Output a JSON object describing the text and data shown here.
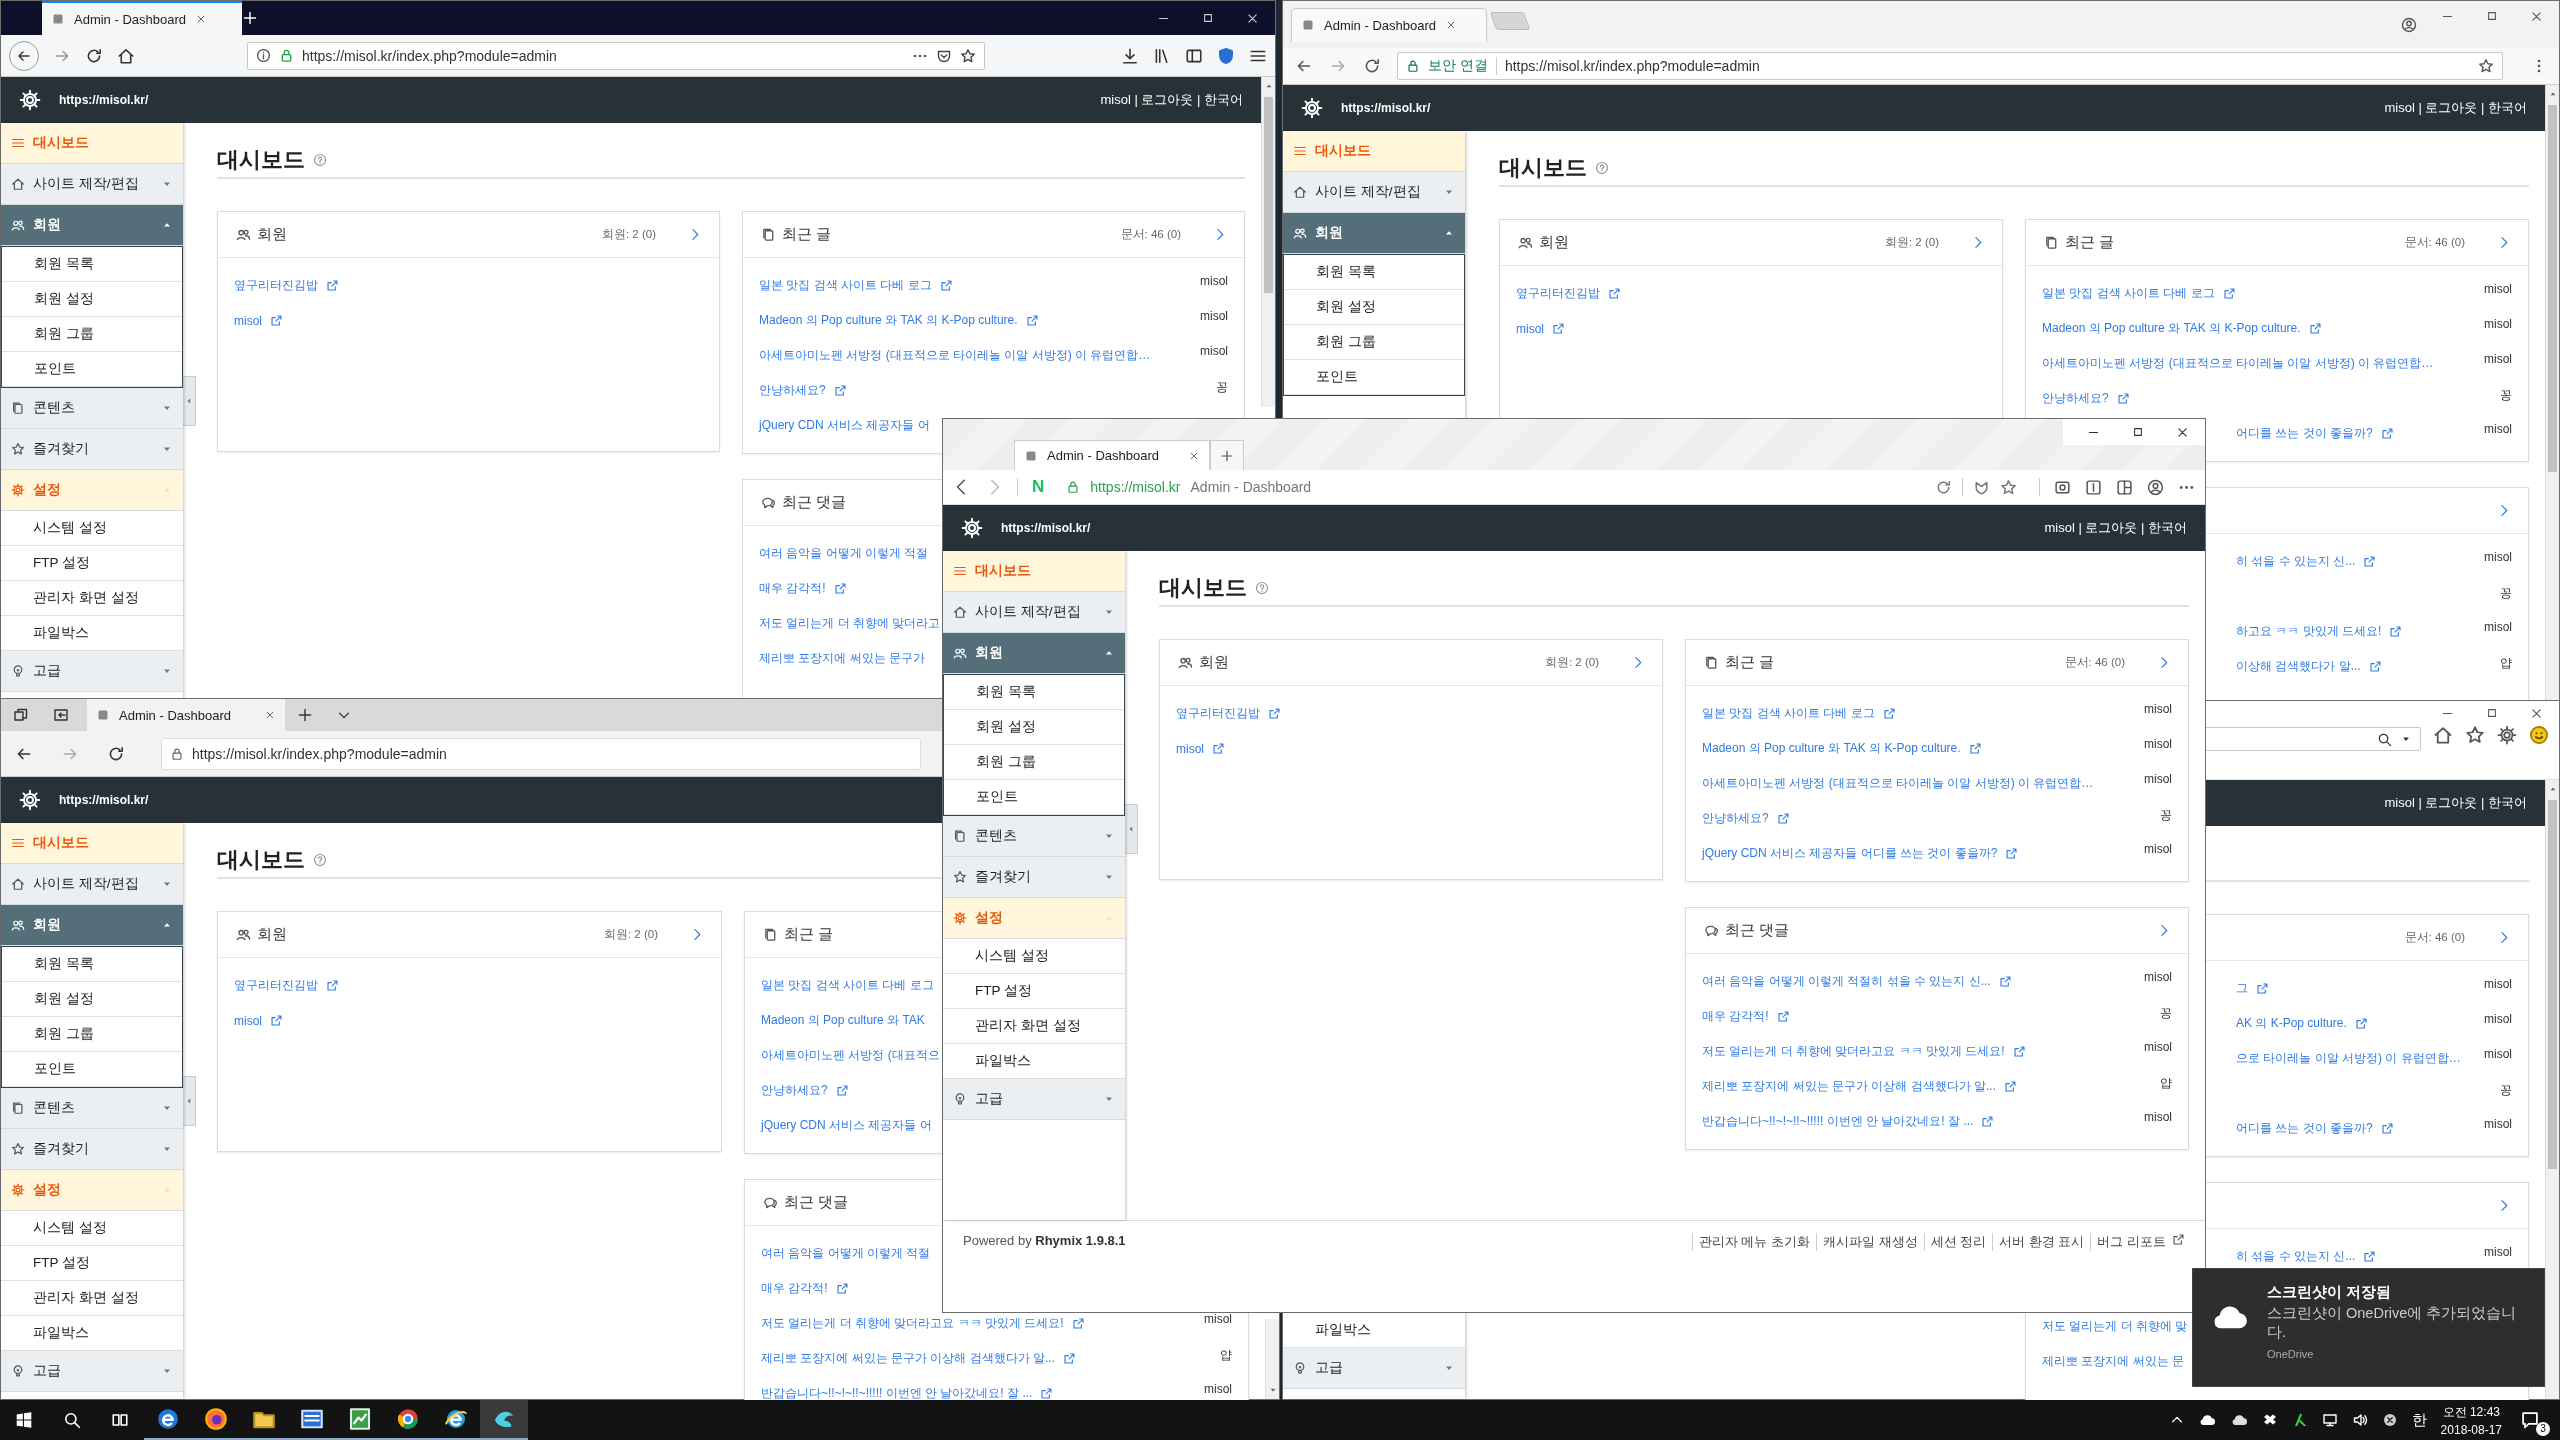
{
  "windows": [
    {
      "kind": "firefox",
      "tabs": [
        {
          "label": "Admin - Dashboard",
          "selected": true
        }
      ],
      "address": "https://misol.kr/index.php?module=admin",
      "site": "https://misol.kr/",
      "account": "misol | 로그아웃 | 한국어",
      "sidebar": [
        {
          "label": "대시보드",
          "kind": "link",
          "selected": true
        },
        {
          "label": "사이트 제작/편집",
          "kind": "group",
          "selected": false,
          "expanded": false
        },
        {
          "label": "회원",
          "kind": "group",
          "selected": false,
          "expanded": true,
          "children": [
            {
              "label": "회원 목록"
            },
            {
              "label": "회원 설정"
            },
            {
              "label": "회원 그룹"
            },
            {
              "label": "포인트"
            }
          ]
        },
        {
          "label": "콘텐츠",
          "kind": "group",
          "selected": false,
          "expanded": false
        },
        {
          "label": "즐겨찾기",
          "kind": "group",
          "selected": false,
          "expanded": false
        },
        {
          "label": "설정",
          "kind": "group",
          "selected": true,
          "expanded": true,
          "children": [
            {
              "label": "시스템 설정"
            },
            {
              "label": "FTP 설정"
            },
            {
              "label": "관리자 화면 설정"
            },
            {
              "label": "파일박스"
            }
          ]
        },
        {
          "label": "고급",
          "kind": "group",
          "selected": false,
          "expanded": false
        }
      ],
      "title": "대시보드",
      "cards": [
        {
          "title": "회원",
          "count": "회원: 2 (0)",
          "rows": [
            {
              "text": "옆구리터진김밥",
              "kind": "link"
            },
            {
              "text": "misol",
              "kind": "link"
            }
          ]
        },
        {
          "title": "최근 글",
          "count": "문서: 46 (0)",
          "rows": [
            {
              "text": "일본 맛집 검색 사이트 다베 로그",
              "kind": "link",
              "author": "misol"
            },
            {
              "text": "Madeon 의 Pop culture 와 TAK 의 K-Pop culture.",
              "kind": "link",
              "author": "misol"
            },
            {
              "text": "아세트아미노펜 서방정 (대표적으로 타이레놀 이알 서방정) 이 유럽연합…",
              "kind": "text",
              "author": "misol"
            },
            {
              "text": "안냥하세요?",
              "kind": "link",
              "author": "꽁"
            },
            {
              "text": "jQuery CDN 서비스 제공자들 어",
              "kind": "text"
            }
          ]
        },
        {
          "title": "최근 댓글",
          "rows": [
            {
              "text": "여러 음악을 어떻게 이렇게 적절",
              "kind": "text"
            },
            {
              "text": "매우 감각적!",
              "kind": "link"
            },
            {
              "text": "저도 얼리는게 더 취향에 맞더라고",
              "kind": "text"
            },
            {
              "text": "제리뽀 포장지에 써있는 문구가",
              "kind": "text"
            }
          ]
        }
      ]
    },
    {
      "kind": "chrome",
      "tabs": [
        {
          "label": "Admin - Dashboard",
          "selected": true
        }
      ],
      "security": "보안 연결",
      "address": "https://misol.kr/index.php?module=admin",
      "site": "https://misol.kr/",
      "account": "misol | 로그아웃 | 한국어",
      "sidebar": [
        {
          "label": "대시보드",
          "kind": "link",
          "selected": true
        },
        {
          "label": "사이트 제작/편집",
          "kind": "group",
          "selected": false,
          "expanded": false
        },
        {
          "label": "회원",
          "kind": "group",
          "selected": false,
          "expanded": true,
          "children": [
            {
              "label": "회원 목록"
            },
            {
              "label": "회원 설정"
            },
            {
              "label": "회원 그룹"
            },
            {
              "label": "포인트"
            }
          ]
        }
      ],
      "title": "대시보드",
      "cards": [
        {
          "title": "회원",
          "count": "회원: 2 (0)",
          "rows": [
            {
              "text": "옆구리터진김밥",
              "kind": "link"
            },
            {
              "text": "misol",
              "kind": "link"
            }
          ]
        },
        {
          "title": "최근 글",
          "count": "문서: 46 (0)",
          "rows": [
            {
              "text": "일본 맛집 검색 사이트 다베 로그",
              "kind": "link",
              "author": "misol"
            },
            {
              "text": "Madeon 의 Pop culture 와 TAK 의 K-Pop culture.",
              "kind": "link",
              "author": "misol"
            },
            {
              "text": "아세트아미노펜 서방정 (대표적으로 타이레놀 이알 서방정) 이 유럽연합…",
              "kind": "text",
              "author": "misol"
            },
            {
              "text": "안냥하세요?",
              "kind": "link",
              "author": "꽁"
            },
            {
              "text": "어디를 쓰는 것이 좋을까?",
              "kind": "tail-link",
              "author": "misol"
            }
          ]
        },
        {
          "rows": [
            {
              "text": "히 섞을 수 있는지 신...",
              "kind": "tail-link",
              "author": "misol"
            },
            {
              "kind": "blank",
              "author": "꽁"
            },
            {
              "text": "하고요 ㅋㅋ 맛있게 드세요!",
              "kind": "tail-link",
              "author": "misol"
            },
            {
              "text": "이상해 검색했다가 알...",
              "kind": "tail-link",
              "author": "얍"
            }
          ]
        }
      ]
    },
    {
      "kind": "whale",
      "tabs": [
        {
          "label": "Admin - Dashboard",
          "selected": true
        }
      ],
      "home_button": "N",
      "address": "https://misol.kr",
      "address_title": "Admin - Dashboard",
      "site": "https://misol.kr/",
      "account": "misol | 로그아웃 | 한국어",
      "sidebar": [
        {
          "label": "대시보드",
          "kind": "link",
          "selected": true
        },
        {
          "label": "사이트 제작/편집",
          "kind": "group",
          "selected": false,
          "expanded": false
        },
        {
          "label": "회원",
          "kind": "group",
          "selected": false,
          "expanded": true,
          "children": [
            {
              "label": "회원 목록"
            },
            {
              "label": "회원 설정"
            },
            {
              "label": "회원 그룹"
            },
            {
              "label": "포인트"
            }
          ]
        },
        {
          "label": "콘텐츠",
          "kind": "group",
          "selected": false,
          "expanded": false
        },
        {
          "label": "즐겨찾기",
          "kind": "group",
          "selected": false,
          "expanded": false
        },
        {
          "label": "설정",
          "kind": "group",
          "selected": true,
          "expanded": true,
          "children": [
            {
              "label": "시스템 설정"
            },
            {
              "label": "FTP 설정"
            },
            {
              "label": "관리자 화면 설정"
            },
            {
              "label": "파일박스"
            }
          ]
        },
        {
          "label": "고급",
          "kind": "group",
          "selected": false,
          "expanded": false
        }
      ],
      "title": "대시보드",
      "cards": [
        {
          "title": "회원",
          "count": "회원: 2 (0)",
          "rows": [
            {
              "text": "옆구리터진김밥",
              "kind": "link"
            },
            {
              "text": "misol",
              "kind": "link"
            }
          ]
        },
        {
          "title": "최근 글",
          "count": "문서: 46 (0)",
          "rows": [
            {
              "text": "일본 맛집 검색 사이트 다베 로그",
              "kind": "link",
              "author": "misol"
            },
            {
              "text": "Madeon 의 Pop culture 와 TAK 의 K-Pop culture.",
              "kind": "link",
              "author": "misol"
            },
            {
              "text": "아세트아미노펜 서방정 (대표적으로 타이레놀 이알 서방정) 이 유럽연합…",
              "kind": "text",
              "author": "misol"
            },
            {
              "text": "안냥하세요?",
              "kind": "link",
              "author": "꽁"
            },
            {
              "text": "jQuery CDN 서비스 제공자들 어디를 쓰는 것이 좋을까?",
              "kind": "link",
              "author": "misol"
            }
          ]
        },
        {
          "title": "최근 댓글",
          "rows": [
            {
              "text": "여러 음악을 어떻게 이렇게 적절히 섞을 수 있는지 신...",
              "kind": "link",
              "author": "misol"
            },
            {
              "text": "매우 감각적!",
              "kind": "link",
              "author": "꽁"
            },
            {
              "text": "저도 얼리는게 더 취향에 맞더라고요 ㅋㅋ 맛있게 드세요!",
              "kind": "link",
              "author": "misol"
            },
            {
              "text": "제리뽀 포장지에 써있는 문구가 이상해 검색했다가 알...",
              "kind": "link",
              "author": "얍"
            },
            {
              "text": "반갑습니다~!!~!~!!~!!!!! 이번엔 안 날아갔네요! 잘 ...",
              "kind": "link",
              "author": "misol"
            }
          ]
        }
      ],
      "footer": {
        "powered": "Powered by **Rhymix 1.9.8.1**",
        "links": [
          "관리자 메뉴 초기화",
          "캐시파일 재생성",
          "세션 정리",
          "서버 환경 표시",
          "버그 리포트"
        ]
      }
    },
    {
      "kind": "edge",
      "tabs": [
        {
          "label": "Admin - Dashboard",
          "selected": true
        }
      ],
      "address": "https://misol.kr/index.php?module=admin",
      "site": "https://misol.kr/",
      "sidebar": [
        {
          "label": "대시보드",
          "kind": "link",
          "selected": true
        },
        {
          "label": "사이트 제작/편집",
          "kind": "group",
          "selected": false,
          "expanded": false
        },
        {
          "label": "회원",
          "kind": "group",
          "selected": false,
          "expanded": true,
          "children": [
            {
              "label": "회원 목록"
            },
            {
              "label": "회원 설정"
            },
            {
              "label": "회원 그룹"
            },
            {
              "label": "포인트"
            }
          ]
        },
        {
          "label": "콘텐츠",
          "kind": "group",
          "selected": false,
          "expanded": false
        },
        {
          "label": "즐겨찾기",
          "kind": "group",
          "selected": false,
          "expanded": false
        },
        {
          "label": "설정",
          "kind": "group",
          "selected": true,
          "expanded": true,
          "children": [
            {
              "label": "시스템 설정"
            },
            {
              "label": "FTP 설정"
            },
            {
              "label": "관리자 화면 설정"
            },
            {
              "label": "파일박스"
            }
          ]
        },
        {
          "label": "고급",
          "kind": "group",
          "selected": false,
          "expanded": false
        }
      ],
      "title": "대시보드",
      "cards": [
        {
          "title": "회원",
          "count": "회원: 2 (0)",
          "rows": [
            {
              "text": "옆구리터진김밥",
              "kind": "link"
            },
            {
              "text": "misol",
              "kind": "link"
            }
          ]
        },
        {
          "title": "최근 글",
          "rows": [
            {
              "text": "일본 맛집 검색 사이트 다베 로그",
              "kind": "text"
            },
            {
              "text": "Madeon 의 Pop culture 와 TAK",
              "kind": "text"
            },
            {
              "text": "아세트아미노펜 서방정 (대표적으",
              "kind": "text"
            },
            {
              "text": "안냥하세요?",
              "kind": "link"
            },
            {
              "text": "jQuery CDN 서비스 제공자들 어",
              "kind": "text"
            }
          ]
        },
        {
          "title": "최근 댓글",
          "rows": [
            {
              "text": "여러 음악을 어떻게 이렇게 적절",
              "kind": "text"
            },
            {
              "text": "매우 감각적!",
              "kind": "link"
            },
            {
              "text": "저도 얼리는게 더 취향에 맞더라고요 ㅋㅋ 맛있게 드세요!",
              "kind": "link",
              "author": "misol"
            },
            {
              "text": "제리뽀 포장지에 써있는 문구가 이상해 검색했다가 알...",
              "kind": "link",
              "author": "얍"
            },
            {
              "text": "반갑습니다~!!~!~!!~!!!!! 이번엔 안 날아갔네요! 잘 ...",
              "kind": "link",
              "author": "misol"
            }
          ]
        }
      ]
    },
    {
      "kind": "ie",
      "account": "misol | 로그아웃 | 한국어",
      "sidebar": [
        {
          "label": "파일박스",
          "kind": "child"
        },
        {
          "label": "고급",
          "kind": "group",
          "selected": false,
          "expanded": false
        }
      ],
      "cards": [
        {
          "count": "문서: 46 (0)",
          "rows": [
            {
              "text": "그",
              "kind": "tail-link",
              "author": "misol"
            },
            {
              "text": "AK 의 K-Pop culture.",
              "kind": "tail-link",
              "author": "misol"
            },
            {
              "text": "으로 타이레놀 이알 서방정) 이 유럽연합…",
              "kind": "tail-text",
              "author": "misol"
            },
            {
              "kind": "blank",
              "author": "꽁"
            },
            {
              "text": "어디를 쓰는 것이 좋을까?",
              "kind": "tail-link",
              "author": "misol"
            }
          ]
        },
        {
          "rows": [
            {
              "text": "히 섞을 수 있는지 신...",
              "kind": "tail-link",
              "author": "misol"
            },
            {
              "kind": "blank"
            },
            {
              "text": "저도 얼리는게 더 취향에 맞",
              "kind": "text"
            },
            {
              "text": "제리뽀 포장지에 써있는 문",
              "kind": "text"
            }
          ]
        }
      ]
    }
  ],
  "toast": {
    "title": "스크린샷이 저장됨",
    "message": "스크린샷이 OneDrive에 추가되었습니다.",
    "source": "OneDrive"
  },
  "taskbar": {
    "apps": [
      {
        "selected": false
      },
      {
        "selected": false
      },
      {
        "selected": false
      },
      {
        "selected": false
      },
      {
        "selected": false
      },
      {
        "selected": false
      },
      {
        "selected": false
      },
      {
        "selected": true
      }
    ],
    "ime": "한",
    "time": "오전 12:43",
    "date": "2018-08-17",
    "notifications": "3"
  }
}
